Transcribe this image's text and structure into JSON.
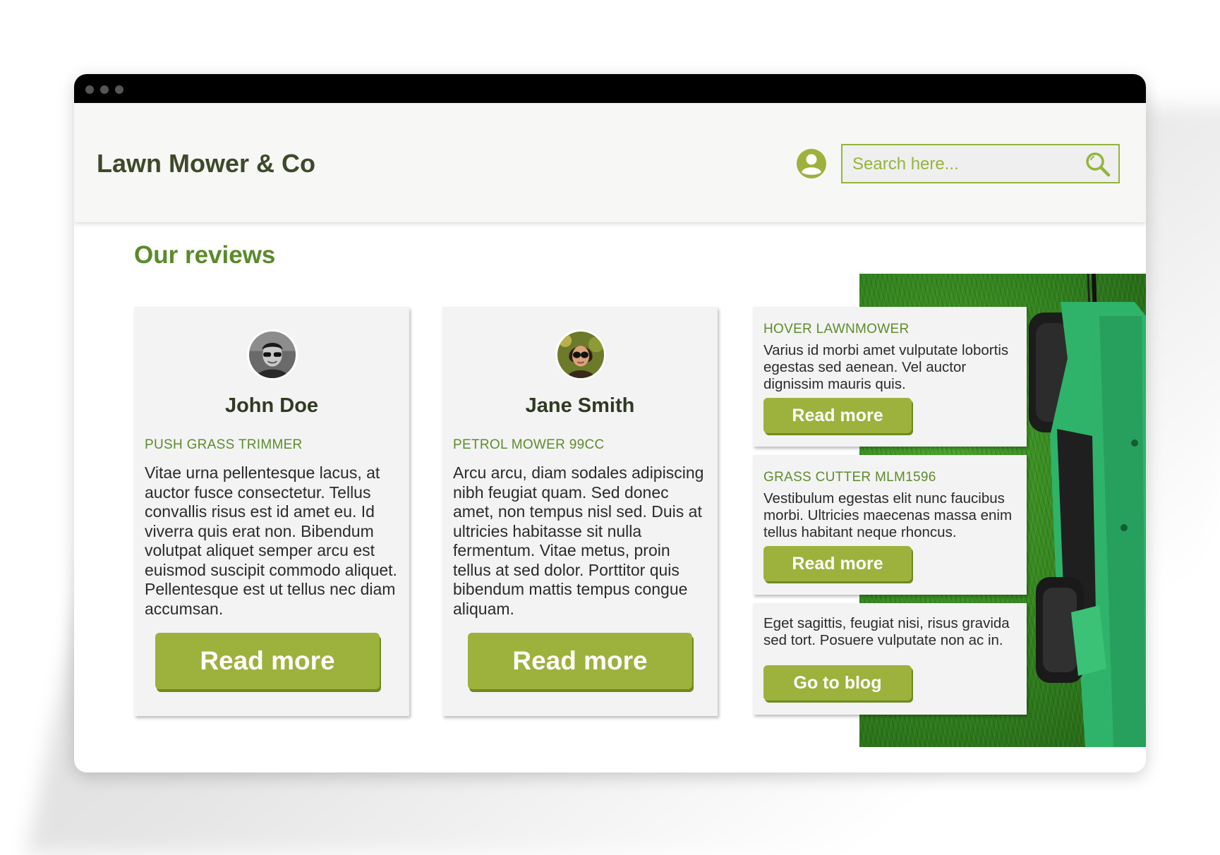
{
  "header": {
    "brand": "Lawn Mower & Co",
    "search_placeholder": "Search here..."
  },
  "main": {
    "section_title": "Our reviews",
    "reviews": [
      {
        "name": "John Doe",
        "product": "PUSH GRASS TRIMMER",
        "text": "Vitae urna pellentesque lacus, at auctor fusce consectetur. Tellus convallis risus est id amet eu. Id viverra quis erat non. Bibendum volutpat aliquet semper arcu est euismod suscipit commodo aliquet. Pellentesque est ut tellus nec diam accumsan.",
        "button": "Read more"
      },
      {
        "name": "Jane Smith",
        "product": "PETROL MOWER 99CC",
        "text": "Arcu arcu, diam sodales adipiscing nibh feugiat quam. Sed donec amet, non tempus nisl sed. Duis at ultricies habitasse sit nulla fermentum. Vitae metus, proin tellus at sed dolor. Porttitor quis bibendum mattis tempus congue aliquam.",
        "button": "Read more"
      }
    ],
    "side_cards": [
      {
        "title": "HOVER LAWNMOWER",
        "text": "Varius id morbi amet vulputate lobortis egestas sed aenean. Vel auctor dignissim mauris quis.",
        "button": "Read more"
      },
      {
        "title": "GRASS CUTTER MLM1596",
        "text": "Vestibulum egestas elit nunc faucibus morbi. Ultricies maecenas massa enim tellus habitant neque rhoncus.",
        "button": "Read more"
      },
      {
        "text": "Eget sagittis, feugiat nisi, risus gravida sed tort. Posuere vulputate non ac in.",
        "button": "Go to blog"
      }
    ]
  },
  "colors": {
    "accent": "#9db13d",
    "heading_green": "#5a8a2a",
    "brand_text": "#3d4a2b",
    "card_bg": "#f3f3f3"
  },
  "icons": [
    "user-icon",
    "search-icon"
  ]
}
